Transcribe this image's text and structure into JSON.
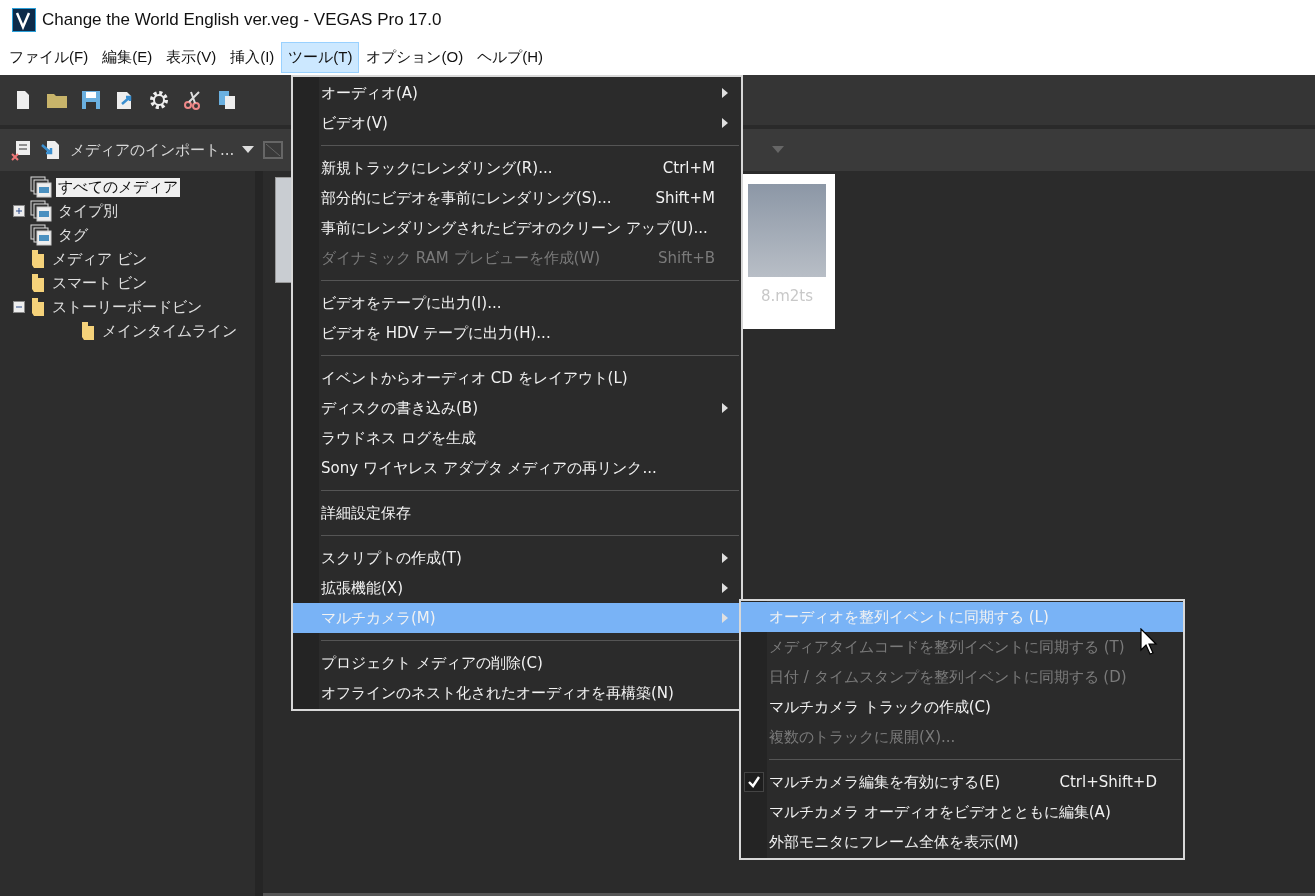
{
  "window": {
    "title": "Change the World English ver.veg - VEGAS Pro 17.0"
  },
  "menubar": [
    {
      "label": "ファイル(F)",
      "selected": false
    },
    {
      "label": "編集(E)",
      "selected": false
    },
    {
      "label": "表示(V)",
      "selected": false
    },
    {
      "label": "挿入(I)",
      "selected": false
    },
    {
      "label": "ツール(T)",
      "selected": true
    },
    {
      "label": "オプション(O)",
      "selected": false
    },
    {
      "label": "ヘルプ(H)",
      "selected": false
    }
  ],
  "media_panel": {
    "import_label": "メディアのインポート...",
    "tree": [
      {
        "label": "すべてのメディア",
        "kind": "library",
        "selected": true
      },
      {
        "label": "タイプ別",
        "kind": "library",
        "selected": false,
        "expanded": false
      },
      {
        "label": "タグ",
        "kind": "library",
        "selected": false
      },
      {
        "label": "メディア ビン",
        "kind": "folder",
        "selected": false
      },
      {
        "label": "スマート ビン",
        "kind": "folder",
        "selected": false
      },
      {
        "label": "ストーリーボードビン",
        "kind": "folder",
        "selected": false,
        "expanded": true,
        "children": [
          {
            "label": "メインタイムライン",
            "kind": "folder",
            "selected": false
          }
        ]
      }
    ],
    "thumbnails": [
      {
        "kind": "cut_off"
      },
      {
        "kind": "card",
        "caption": "8.m2ts"
      }
    ]
  },
  "tools_menu": [
    {
      "kind": "item",
      "label": "オーディオ(A)",
      "disabled": false,
      "submenu": true,
      "selected": false
    },
    {
      "kind": "item",
      "label": "ビデオ(V)",
      "disabled": false,
      "submenu": true,
      "selected": false
    },
    {
      "kind": "separator"
    },
    {
      "kind": "item",
      "label": "新規トラックにレンダリング(R)...",
      "shortcut": "Ctrl+M",
      "disabled": false,
      "submenu": false,
      "selected": false
    },
    {
      "kind": "item",
      "label": "部分的にビデオを事前にレンダリング(S)...",
      "shortcut": "Shift+M",
      "disabled": false,
      "submenu": false,
      "selected": false
    },
    {
      "kind": "item",
      "label": "事前にレンダリングされたビデオのクリーン アップ(U)...",
      "disabled": false,
      "submenu": false,
      "selected": false
    },
    {
      "kind": "item",
      "label": "ダイナミック RAM プレビューを作成(W)",
      "shortcut": "Shift+B",
      "disabled": true,
      "submenu": false,
      "selected": false
    },
    {
      "kind": "separator"
    },
    {
      "kind": "item",
      "label": "ビデオをテープに出力(I)...",
      "disabled": false,
      "submenu": false,
      "selected": false
    },
    {
      "kind": "item",
      "label": "ビデオを HDV テープに出力(H)...",
      "disabled": false,
      "submenu": false,
      "selected": false
    },
    {
      "kind": "separator"
    },
    {
      "kind": "item",
      "label": "イベントからオーディオ CD をレイアウト(L)",
      "disabled": false,
      "submenu": false,
      "selected": false
    },
    {
      "kind": "item",
      "label": "ディスクの書き込み(B)",
      "disabled": false,
      "submenu": true,
      "selected": false
    },
    {
      "kind": "item",
      "label": "ラウドネス ログを生成",
      "disabled": false,
      "submenu": false,
      "selected": false
    },
    {
      "kind": "item",
      "label": "Sony ワイヤレス アダプタ メディアの再リンク...",
      "disabled": false,
      "submenu": false,
      "selected": false
    },
    {
      "kind": "separator"
    },
    {
      "kind": "item",
      "label": "詳細設定保存",
      "disabled": false,
      "submenu": false,
      "selected": false
    },
    {
      "kind": "separator"
    },
    {
      "kind": "item",
      "label": "スクリプトの作成(T)",
      "disabled": false,
      "submenu": true,
      "selected": false
    },
    {
      "kind": "item",
      "label": "拡張機能(X)",
      "disabled": false,
      "submenu": true,
      "selected": false
    },
    {
      "kind": "item",
      "label": "マルチカメラ(M)",
      "disabled": false,
      "submenu": true,
      "selected": true
    },
    {
      "kind": "separator"
    },
    {
      "kind": "item",
      "label": "プロジェクト メディアの削除(C)",
      "disabled": false,
      "submenu": false,
      "selected": false
    },
    {
      "kind": "item",
      "label": "オフラインのネスト化されたオーディオを再構築(N)",
      "disabled": false,
      "submenu": false,
      "selected": false
    }
  ],
  "multicam_submenu": [
    {
      "kind": "item",
      "label": "オーディオを整列イベントに同期する (L)",
      "disabled": false,
      "checked": false,
      "selected": true
    },
    {
      "kind": "item",
      "label": "メディアタイムコードを整列イベントに同期する (T)",
      "disabled": true,
      "checked": false,
      "selected": false
    },
    {
      "kind": "item",
      "label": "日付 / タイムスタンプを整列イベントに同期する (D)",
      "disabled": true,
      "checked": false,
      "selected": false
    },
    {
      "kind": "item",
      "label": "マルチカメラ トラックの作成(C)",
      "disabled": false,
      "checked": false,
      "selected": false
    },
    {
      "kind": "item",
      "label": "複数のトラックに展開(X)...",
      "disabled": true,
      "checked": false,
      "selected": false
    },
    {
      "kind": "separator"
    },
    {
      "kind": "item",
      "label": "マルチカメラ編集を有効にする(E)",
      "shortcut": "Ctrl+Shift+D",
      "disabled": false,
      "checked": true,
      "selected": false
    },
    {
      "kind": "item",
      "label": "マルチカメラ オーディオをビデオとともに編集(A)",
      "disabled": false,
      "checked": false,
      "selected": false
    },
    {
      "kind": "item",
      "label": "外部モニタにフレーム全体を表示(M)",
      "disabled": false,
      "checked": false,
      "selected": false
    }
  ]
}
